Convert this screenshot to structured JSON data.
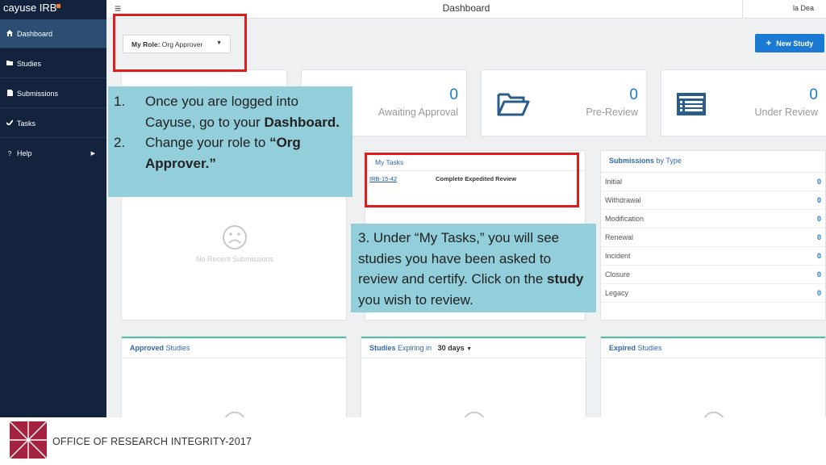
{
  "app": {
    "brand": "cayuse IRB",
    "title": "Dashboard",
    "user": "la Dea"
  },
  "sidebar": {
    "items": [
      {
        "label": "Dashboard",
        "icon": "home-icon"
      },
      {
        "label": "Studies",
        "icon": "folder-icon"
      },
      {
        "label": "Submissions",
        "icon": "document-icon"
      },
      {
        "label": "Tasks",
        "icon": "checkmark-icon"
      },
      {
        "label": "Help",
        "icon": "question-icon"
      }
    ]
  },
  "role": {
    "label": "My Role:",
    "value": "Org Approver"
  },
  "new_study": "New Study",
  "stats": [
    {
      "value": "0",
      "label": "Awaiting Approval"
    },
    {
      "value": "0",
      "label": "Pre-Review"
    },
    {
      "value": "0",
      "label": "Under Review"
    }
  ],
  "recent": {
    "empty": "No Recent Submissions"
  },
  "tasks": {
    "title": "My Tasks",
    "rows": [
      {
        "id": "IRB-15-42",
        "task": "Complete Expedited Review"
      }
    ]
  },
  "submissions_by_type": {
    "title_bold": "Submissions",
    "title_rest": " by Type",
    "rows": [
      {
        "type": "Initial",
        "count": "0"
      },
      {
        "type": "Withdrawal",
        "count": "0"
      },
      {
        "type": "Modification",
        "count": "0"
      },
      {
        "type": "Renewal",
        "count": "0"
      },
      {
        "type": "Incident",
        "count": "0"
      },
      {
        "type": "Closure",
        "count": "0"
      },
      {
        "type": "Legacy",
        "count": "0"
      }
    ]
  },
  "approved": {
    "title_bold": "Approved",
    "title_rest": " Studies"
  },
  "expiring": {
    "title_bold": "Studies",
    "title_rest": " Expiring in",
    "days": "30 days"
  },
  "expired": {
    "title_bold": "Expired",
    "title_rest": " Studies"
  },
  "callouts": {
    "c1": {
      "n1": "1.",
      "line1": "Once you are logged into Cayuse, go to your",
      "line1_bold": "Dashboard.",
      "n2": "2.",
      "line2": "Change your role to",
      "line2_bold": "“Org Approver.”"
    },
    "c2": {
      "text": "3. Under “My Tasks,” you will see studies you have been asked to review and certify.  Click on the",
      "bold": "study",
      "end": " you wish to review."
    }
  },
  "footer": {
    "text": "OFFICE OF RESEARCH INTEGRITY-2017"
  },
  "colors": {
    "sidebar": "#13233d",
    "accent": "#1a7ad4",
    "callout": "#92cfdb",
    "highlight": "#e21b1b"
  }
}
